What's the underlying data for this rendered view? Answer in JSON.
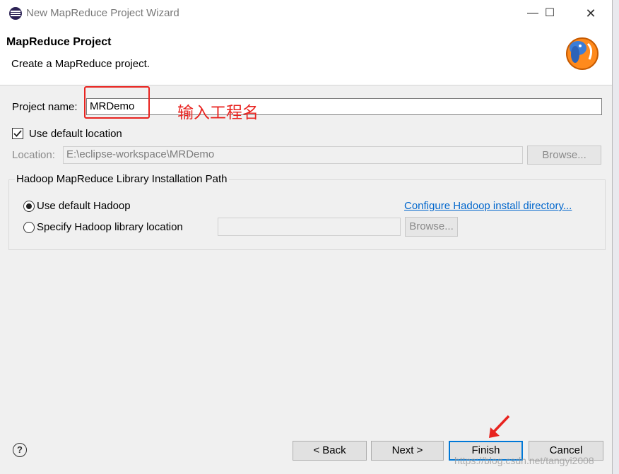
{
  "window": {
    "title": "New MapReduce Project Wizard"
  },
  "header": {
    "title": "MapReduce Project",
    "description": "Create a MapReduce project."
  },
  "form": {
    "project_name_label": "Project name:",
    "project_name_value": "MRDemo",
    "use_default_location_label": "Use default location",
    "use_default_location_checked": true,
    "location_label": "Location:",
    "location_value": "E:\\eclipse-workspace\\MRDemo",
    "browse_label": "Browse..."
  },
  "hadoop_group": {
    "title": "Hadoop MapReduce Library Installation Path",
    "use_default_label": "Use default Hadoop",
    "configure_link": "Configure Hadoop install directory...",
    "specify_label": "Specify Hadoop library location",
    "browse_label": "Browse..."
  },
  "annotation": {
    "text": "输入工程名",
    "color": "#e8231f"
  },
  "buttons": {
    "back": "< Back",
    "next": "Next >",
    "finish": "Finish",
    "cancel": "Cancel"
  },
  "help": {
    "glyph": "?"
  },
  "watermark": "https://blog.csdn.net/tangyi2008",
  "colors": {
    "accent": "#0078d7",
    "link": "#0066cc",
    "annotation": "#e8231f"
  }
}
